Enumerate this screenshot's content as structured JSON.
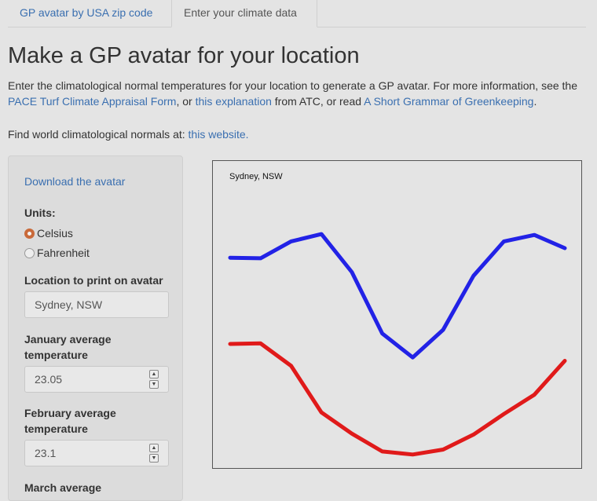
{
  "tabs": [
    {
      "label": "GP avatar by USA zip code",
      "active": false
    },
    {
      "label": "Enter your climate data",
      "active": true
    }
  ],
  "page": {
    "title": "Make a GP avatar for your location",
    "intro_1": "Enter the climatological normal temperatures for your location to generate a GP avatar. For more information, see the ",
    "link_pace": "PACE Turf Climate Appraisal Form",
    "intro_2": ", or ",
    "link_explanation": "this explanation",
    "intro_3": " from ATC, or read ",
    "link_grammar": "A Short Grammar of Greenkeeping",
    "intro_4": ".",
    "world_text": "Find world climatological normals at: ",
    "world_link": "this website."
  },
  "sidebar": {
    "download_label": "Download the avatar",
    "units_label": "Units:",
    "units_options": [
      "Celsius",
      "Fahrenheit"
    ],
    "units_selected": "Celsius",
    "location_label": "Location to print on avatar",
    "location_value": "Sydney, NSW",
    "jan_label_1": "January average",
    "jan_label_2": "temperature",
    "jan_value": "23.05",
    "feb_label_1": "February average",
    "feb_label_2": "temperature",
    "feb_value": "23.1",
    "mar_label_1": "March average"
  },
  "plot": {
    "title": "Sydney, NSW",
    "colors": {
      "upper": "#2222e6",
      "lower": "#e01a1a"
    }
  },
  "chart_data": {
    "type": "line",
    "title": "Sydney, NSW",
    "xlabel": "",
    "ylabel": "",
    "x": [
      1,
      2,
      3,
      4,
      5,
      6,
      7,
      8,
      9,
      10,
      11,
      12
    ],
    "ylim": [
      0,
      100
    ],
    "grid": false,
    "series": [
      {
        "color": "#2222e6",
        "values": [
          68.5,
          68.3,
          73.8,
          76.2,
          63.8,
          43.8,
          36.0,
          45.0,
          62.6,
          73.8,
          75.9,
          71.6
        ]
      },
      {
        "color": "#e01a1a",
        "values": [
          40.4,
          40.6,
          33.3,
          18.1,
          11.2,
          5.4,
          4.4,
          6.0,
          10.9,
          17.6,
          23.9,
          34.9
        ]
      }
    ]
  }
}
